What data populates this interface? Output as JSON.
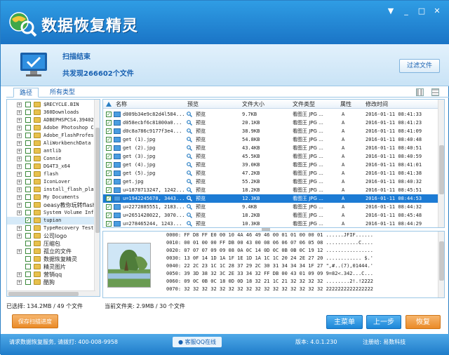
{
  "app": {
    "title": "数据恢复精灵",
    "menu_icon": "▼",
    "min_icon": "_",
    "max_icon": "□",
    "close_icon": "✕"
  },
  "status": {
    "title": "扫描结束",
    "found": "共发现266602个文件",
    "filter_label": "过滤文件"
  },
  "tabs": {
    "path": "路径",
    "types": "所有类型"
  },
  "tree": [
    {
      "label": "$RECYCLE.BIN",
      "exp": "+",
      "checked": false
    },
    {
      "label": "360Downloads",
      "exp": "+",
      "checked": false
    },
    {
      "label": "ADBEPHSPCS4.39402",
      "exp": "+",
      "checked": false
    },
    {
      "label": "Adobe Photoshop C",
      "exp": "+",
      "checked": false
    },
    {
      "label": "Adobe_FlashProfes",
      "exp": "+",
      "checked": false
    },
    {
      "label": "AliWorkbenchData",
      "exp": "+",
      "checked": false
    },
    {
      "label": "antlib",
      "exp": "+",
      "checked": false
    },
    {
      "label": "Connie",
      "exp": "+",
      "checked": false
    },
    {
      "label": "DG4T3_x64",
      "exp": "+",
      "checked": false
    },
    {
      "label": "flash",
      "exp": "+",
      "checked": false
    },
    {
      "label": "IconLover",
      "exp": "+",
      "checked": false
    },
    {
      "label": "install_flash_pla",
      "exp": "+",
      "checked": false
    },
    {
      "label": "My Documents",
      "exp": "+",
      "checked": false
    },
    {
      "label": "oeasy教你玩转flash",
      "exp": "+",
      "checked": false
    },
    {
      "label": "System Volume Info",
      "exp": "+",
      "checked": false
    },
    {
      "label": "tupian",
      "exp": "",
      "checked": true
    },
    {
      "label": "TypeRecovery Test",
      "exp": "+",
      "checked": false
    },
    {
      "label": "公司logo",
      "exp": "+",
      "checked": false
    },
    {
      "label": "压缩包",
      "exp": "",
      "checked": false
    },
    {
      "label": "孤立的文件",
      "exp": "+",
      "checked": false
    },
    {
      "label": "数据恢复精灵",
      "exp": "",
      "checked": false
    },
    {
      "label": "精灵图片",
      "exp": "",
      "checked": false
    },
    {
      "label": "营销qq",
      "exp": "+",
      "checked": false
    },
    {
      "label": "酷狗",
      "exp": "+",
      "checked": false
    }
  ],
  "columns": {
    "name": "名称",
    "preview": "预览",
    "size": "文件大小",
    "type": "文件类型",
    "attr": "属性",
    "modified": "修改时间"
  },
  "files": [
    {
      "name": "d009b34e9c82d4l584...",
      "preview": "预览",
      "size": "9.7KB",
      "type": "看图王 JPG ...",
      "attr": "A",
      "date": "2016-01-11 08:41:33"
    },
    {
      "name": "d058ecbf6c81800a0...",
      "preview": "预览",
      "size": "20.1KB",
      "type": "看图王 JPG ...",
      "attr": "A",
      "date": "2016-01-11 08:41:23"
    },
    {
      "name": "d0c8a786c9177f3e4...",
      "preview": "预览",
      "size": "38.9KB",
      "type": "看图王 JPG ...",
      "attr": "A",
      "date": "2016-01-11 08:41:09"
    },
    {
      "name": "get (1).jpg",
      "preview": "预览",
      "size": "54.8KB",
      "type": "看图王 JPG ...",
      "attr": "A",
      "date": "2016-01-11 08:40:48"
    },
    {
      "name": "get (2).jpg",
      "preview": "预览",
      "size": "43.4KB",
      "type": "看图王 JPG ...",
      "attr": "A",
      "date": "2016-01-11 08:40:51"
    },
    {
      "name": "get (3).jpg",
      "preview": "预览",
      "size": "45.5KB",
      "type": "看图王 JPG ...",
      "attr": "A",
      "date": "2016-01-11 08:40:59"
    },
    {
      "name": "get (4).jpg",
      "preview": "预览",
      "size": "39.0KB",
      "type": "看图王 JPG ...",
      "attr": "A",
      "date": "2016-01-11 08:41:01"
    },
    {
      "name": "get (5).jpg",
      "preview": "预览",
      "size": "47.2KB",
      "type": "看图王 JPG ...",
      "attr": "A",
      "date": "2016-01-11 08:41:38"
    },
    {
      "name": "get.jpg",
      "preview": "预览",
      "size": "55.2KB",
      "type": "看图王 JPG ...",
      "attr": "A",
      "date": "2016-01-11 08:40:32"
    },
    {
      "name": "u=1878713247, 1242...",
      "preview": "预览",
      "size": "18.2KB",
      "type": "看图王 JPG ...",
      "attr": "A",
      "date": "2016-01-11 08:45:51"
    },
    {
      "name": "u=1942245678, 3443...",
      "preview": "预览",
      "size": "12.3KB",
      "type": "看图王 JPG ...",
      "attr": "A",
      "date": "2016-01-11 08:44:53",
      "selected": true
    },
    {
      "name": "u=2272885551, 2183...",
      "preview": "预览",
      "size": "9.4KB",
      "type": "看图王 JPG ...",
      "attr": "A",
      "date": "2016-01-11 08:44:32"
    },
    {
      "name": "u=2651428022, 3070...",
      "preview": "预览",
      "size": "18.2KB",
      "type": "看图王 JPG ...",
      "attr": "A",
      "date": "2016-01-11 08:45:48"
    },
    {
      "name": "u=278465244, 1243...",
      "preview": "预览",
      "size": "10.3KB",
      "type": "看图王 JPG ...",
      "attr": "A",
      "date": "2016-01-11 08:44:29"
    }
  ],
  "hex": [
    {
      "off": "0000:",
      "bytes": "FF D8 FF E0 00 10 4A 46 49 46 00 01 01 00 00 01",
      "text": "......JFIF......"
    },
    {
      "off": "0010:",
      "bytes": "00 01 00 00 FF DB 00 43 00 08 06 06 07 06 05 08",
      "text": "...........C...."
    },
    {
      "off": "0020:",
      "bytes": "07 07 07 09 09 08 0A 0C 14 0D 0C 0B 0B 0C 19 12",
      "text": "................"
    },
    {
      "off": "0030:",
      "bytes": "13 0F 14 1D 1A 1F 1E 1D 1A 1C 1C 20 24 2E 27 20",
      "text": "............ $.'"
    },
    {
      "off": "0040:",
      "bytes": "22 2C 23 1C 1C 28 37 29 2C 30 31 34 34 34 1F 27",
      "text": "\",#..(7),01444.'"
    },
    {
      "off": "0050:",
      "bytes": "39 3D 38 32 3C 2E 33 34 32 FF DB 00 43 01 09 09",
      "text": "9=82<.342...C..."
    },
    {
      "off": "0060:",
      "bytes": "09 0C 0B 0C 18 0D 0D 18 32 21 1C 21 32 32 32 32",
      "text": "........2!.!2222"
    },
    {
      "off": "0070:",
      "bytes": "32 32 32 32 32 32 32 32 32 32 32 32 32 32 32 32",
      "text": "2222222222222222"
    }
  ],
  "footer_info": {
    "selected": "已选择: 134.2MB / 49 个文件",
    "current_folder": "当前文件夹: 2.9MB / 30 个文件"
  },
  "buttons": {
    "save_progress": "保存扫描进度",
    "main_menu": "主菜单",
    "prev": "上一步",
    "recover": "恢复"
  },
  "footer": {
    "contact": "请求数据恢复服务, 请拨打: 400-008-9958",
    "qq": "客服QQ在线",
    "version": "版本: 4.0.1.230",
    "registered": "注册给:   易数科技"
  }
}
